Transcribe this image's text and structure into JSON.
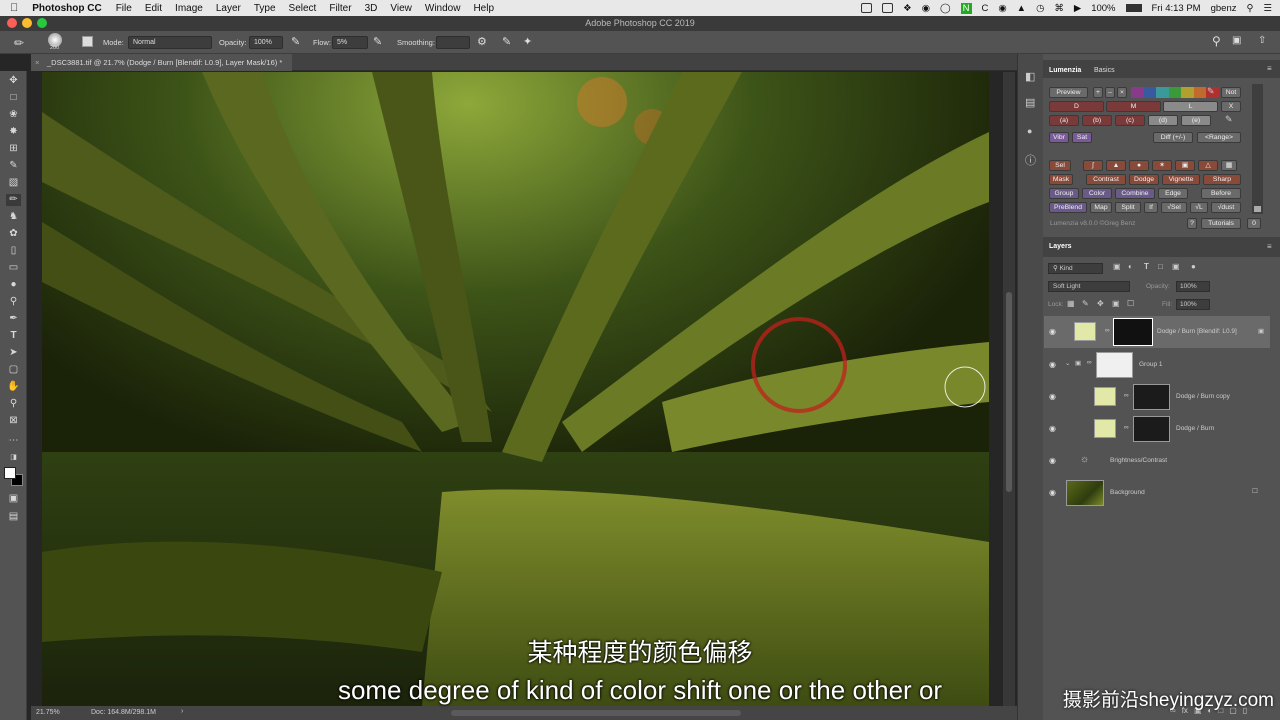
{
  "menubar": {
    "app": "Photoshop CC",
    "items": [
      "File",
      "Edit",
      "Image",
      "Layer",
      "Type",
      "Select",
      "Filter",
      "3D",
      "View",
      "Window",
      "Help"
    ],
    "battery": "100%",
    "clock": "Fri 4:13 PM",
    "user": "gbenz"
  },
  "window_title": "Adobe Photoshop CC 2019",
  "options": {
    "brush_size": "200",
    "mode_label": "Mode:",
    "mode_value": "Normal",
    "opacity_label": "Opacity:",
    "opacity_value": "100%",
    "flow_label": "Flow:",
    "flow_value": "5%",
    "smoothing_label": "Smoothing:"
  },
  "document_tab": "_DSC3881.tif @ 21.7% (Dodge / Burn [Blendif: L0.9], Layer Mask/16) *",
  "status": {
    "zoom": "21.75%",
    "doc": "Doc: 164.8M/298.1M"
  },
  "lumenzia": {
    "tabs": [
      "Lumenzia",
      "Basics"
    ],
    "preview": "Preview",
    "row1": [
      "+",
      "–",
      "×"
    ],
    "not": "Not",
    "dml": [
      "D",
      "M",
      "L"
    ],
    "x": "X",
    "abcde": [
      "(a)",
      "(b)",
      "(c)",
      "(d)",
      "(e)"
    ],
    "vibr": "Vibr",
    "sat": "Sat",
    "diff": "Diff (+/-)",
    "range": "<Range>",
    "sel": "Sel",
    "row_mask": [
      "Mask",
      "Contrast",
      "Dodge",
      "Vignette",
      "Sharp"
    ],
    "row_group": [
      "Group",
      "Color",
      "Combine",
      "Edge",
      "Before"
    ],
    "row_preblend": [
      "PreBlend",
      "Map",
      "Split",
      "If",
      "√Sel",
      "√L",
      "√dust"
    ],
    "version": "Lumenzia v8.0.0 ©Greg Benz",
    "help": "?",
    "tutorials": "Tutorials",
    "zero": "0"
  },
  "layers_panel": {
    "title": "Layers",
    "kind": "Kind",
    "blend_mode": "Soft Light",
    "opacity_label": "Opacity:",
    "opacity_value": "100%",
    "lock_label": "Lock:",
    "fill_label": "Fill:",
    "fill_value": "100%",
    "layers": [
      {
        "name": "Dodge / Burn [Blendif: L0.9]"
      },
      {
        "name": "Group 1"
      },
      {
        "name": "Dodge / Burn copy"
      },
      {
        "name": "Dodge / Burn"
      },
      {
        "name": "Brightness/Contrast"
      },
      {
        "name": "Background"
      }
    ]
  },
  "subtitles": {
    "zh": "某种程度的颜色偏移",
    "en": "some degree of kind of color shift one or the other or"
  },
  "watermark": "摄影前沿sheyingzyz.com"
}
